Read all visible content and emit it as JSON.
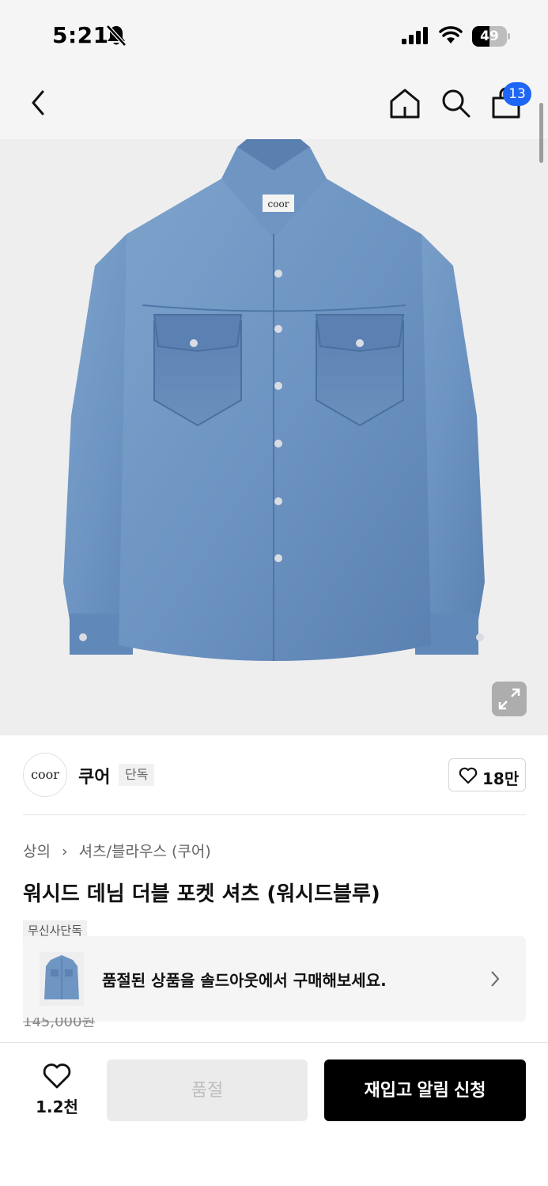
{
  "status_bar": {
    "time": "5:21",
    "battery": "49",
    "battery_level_percent": 49,
    "icons": [
      "bell-slash-icon",
      "signal-icon",
      "wifi-icon",
      "battery-icon"
    ]
  },
  "nav": {
    "icons": [
      "back-chevron-icon",
      "home-icon",
      "search-icon",
      "shopping-bag-icon"
    ],
    "cart_count": "13",
    "badge_color": "#1e66f5"
  },
  "product_image": {
    "logo_text": "coor",
    "zoom_icon": "expand-icon"
  },
  "brand": {
    "logo_text": "coor",
    "name": "쿠어",
    "tag": "단독",
    "like_count": "18만"
  },
  "breadcrumb": {
    "items": [
      "상의",
      "셔츠/블라우스 (쿠어)"
    ]
  },
  "product": {
    "title": "워시드 데님 더블 포켓 셔츠 (워시드블루)",
    "exclusive_label": "무신사단독",
    "original_price": "145,000원"
  },
  "soldout_banner": {
    "text": "품절된 상품을 솔드아웃에서 구매해보세요."
  },
  "bottom_bar": {
    "like_count": "1.2천",
    "soldout_label": "품절",
    "restock_label": "재입고 알림 신청",
    "primary_color": "#000000"
  }
}
